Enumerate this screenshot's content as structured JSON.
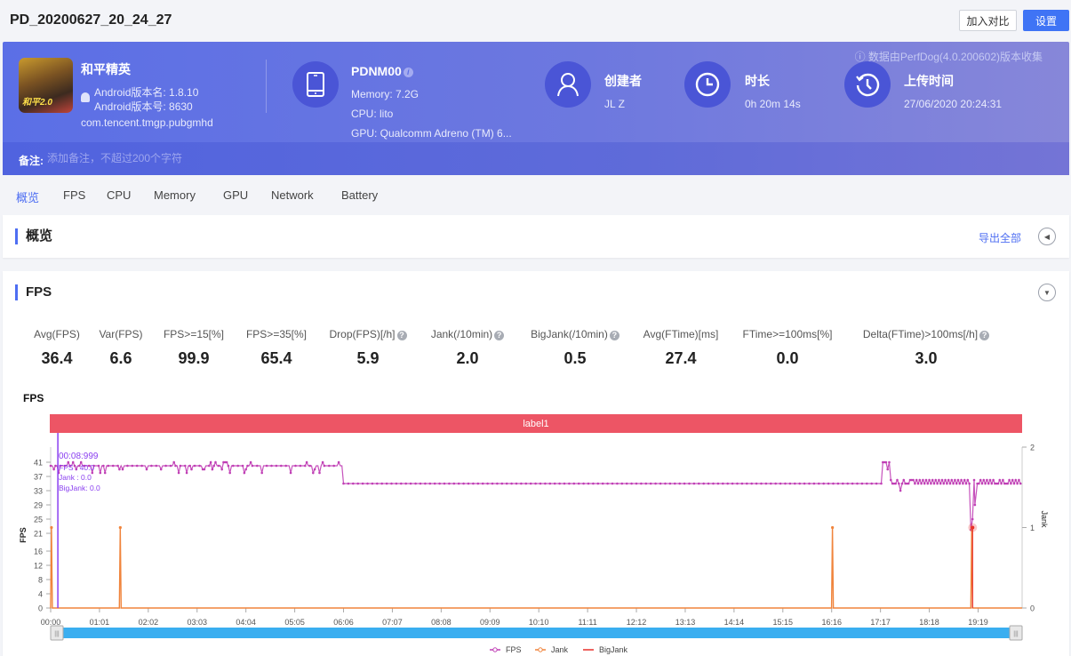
{
  "header": {
    "title": "PD_20200627_20_24_27",
    "compare_button": "加入对比",
    "settings_button": "设置"
  },
  "banner": {
    "source_note": "ⓘ 数据由PerfDog(4.0.200602)版本收集",
    "app": {
      "name": "和平精英",
      "icon_badge": "和平2.0",
      "version_name": "Android版本名: 1.8.10",
      "version_code": "Android版本号: 8630",
      "package": "com.tencent.tmgp.pubgmhd"
    },
    "device": {
      "model": "PDNM00",
      "memory": "Memory: 7.2G",
      "cpu": "CPU: lito",
      "gpu": "GPU: Qualcomm Adreno (TM) 6..."
    },
    "creator": {
      "label": "创建者",
      "value": "JL Z"
    },
    "duration": {
      "label": "时长",
      "value": "0h 20m 14s"
    },
    "upload": {
      "label": "上传时间",
      "value": "27/06/2020 20:24:31"
    },
    "note": {
      "label": "备注:",
      "placeholder": "添加备注，不超过200个字符"
    }
  },
  "tabs": [
    {
      "label": "概览",
      "active": true
    },
    {
      "label": "FPS"
    },
    {
      "label": "CPU"
    },
    {
      "label": "Memory"
    },
    {
      "label": "GPU"
    },
    {
      "label": "Network"
    },
    {
      "label": "Battery"
    }
  ],
  "overview": {
    "title": "概览",
    "export_label": "导出全部"
  },
  "fps_section": {
    "title": "FPS",
    "metrics": [
      {
        "label": "Avg(FPS)",
        "value": "36.4",
        "help": false
      },
      {
        "label": "Var(FPS)",
        "value": "6.6",
        "help": false
      },
      {
        "label": "FPS>=15[%]",
        "value": "99.9",
        "help": false
      },
      {
        "label": "FPS>=35[%]",
        "value": "65.4",
        "help": false
      },
      {
        "label": "Drop(FPS)[/h]",
        "value": "5.9",
        "help": true
      },
      {
        "label": "Jank(/10min)",
        "value": "2.0",
        "help": true
      },
      {
        "label": "BigJank(/10min)",
        "value": "0.5",
        "help": true
      },
      {
        "label": "Avg(FTime)[ms]",
        "value": "27.4",
        "help": false
      },
      {
        "label": "FTime>=100ms[%]",
        "value": "0.0",
        "help": false
      },
      {
        "label": "Delta(FTime)>100ms[/h]",
        "value": "3.0",
        "help": true
      }
    ]
  },
  "chart_data": {
    "type": "line",
    "title": "FPS",
    "label_band": "label1",
    "ylabel": "FPS",
    "y2label": "Jank",
    "yticks": [
      0,
      4,
      8,
      12,
      16,
      21,
      25,
      29,
      33,
      37,
      41
    ],
    "ylim": [
      0,
      45
    ],
    "y2ticks": [
      0,
      1,
      2
    ],
    "y2lim": [
      0,
      2
    ],
    "xlabel": "",
    "xticks": [
      "00:00",
      "01:01",
      "02:02",
      "03:03",
      "04:04",
      "05:05",
      "06:06",
      "07:07",
      "08:08",
      "09:09",
      "10:10",
      "11:11",
      "12:12",
      "13:13",
      "14:14",
      "15:15",
      "16:16",
      "17:17",
      "18:18",
      "19:19"
    ],
    "xlim_seconds": [
      0,
      1214
    ],
    "grid": false,
    "legend_position": "bottom-center",
    "tooltip": {
      "time": "00:08:999",
      "fps": "FPS    : 40.0",
      "jank": "Jank     : 0.0",
      "bigjank": "BigJank: 0.0"
    },
    "series": [
      {
        "name": "FPS",
        "color": "#c03fb5",
        "axis": "left",
        "segments": [
          {
            "from": 0,
            "to": 366,
            "base": 40,
            "noise": [
              39,
              41,
              38
            ]
          },
          {
            "from": 366,
            "to": 1040,
            "base": 35,
            "noise": []
          },
          {
            "from": 1040,
            "to": 1050,
            "base": 40,
            "noise": [
              41,
              39
            ]
          },
          {
            "from": 1050,
            "to": 1214,
            "base": 35.5,
            "noise": [
              35,
              36
            ]
          }
        ],
        "dips": [
          {
            "t": 1150,
            "value": 22
          },
          {
            "t": 1152,
            "value": 25
          },
          {
            "t": 1155,
            "value": 29
          },
          {
            "t": 1062,
            "value": 33
          }
        ]
      },
      {
        "name": "Jank",
        "color": "#f0843c",
        "axis": "right",
        "spikes": [
          {
            "t": 1,
            "value": 1
          },
          {
            "t": 87,
            "value": 1
          },
          {
            "t": 977,
            "value": 1
          },
          {
            "t": 1151,
            "value": 1
          }
        ]
      },
      {
        "name": "BigJank",
        "color": "#e8302a",
        "axis": "right",
        "spikes": [
          {
            "t": 1151,
            "value": 1
          }
        ]
      }
    ],
    "cursor_seconds": 9
  }
}
